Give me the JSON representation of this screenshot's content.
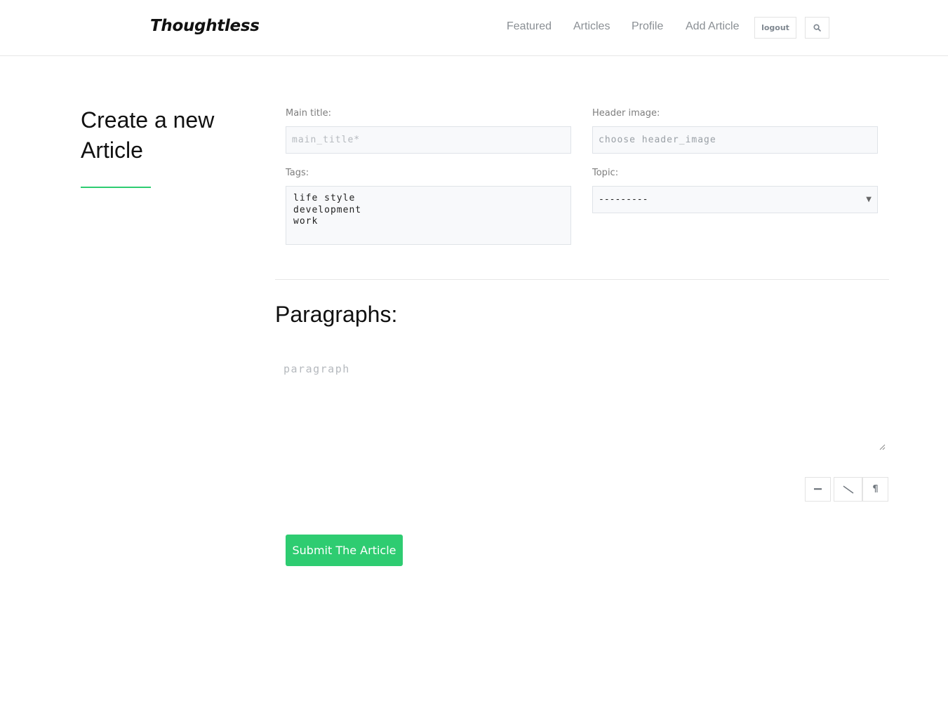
{
  "header": {
    "brand": "Thoughtless",
    "nav": {
      "featured": "Featured",
      "articles": "Articles",
      "profile": "Profile",
      "add_article": "Add Article"
    },
    "logout_label": "logout",
    "search_icon": "search-icon"
  },
  "page": {
    "heading": "Create a new Article",
    "accent_color": "#2ecc71"
  },
  "form": {
    "main_title": {
      "label": "Main title:",
      "placeholder": "main_title*"
    },
    "header_image": {
      "label": "Header image:",
      "placeholder": "choose header_image"
    },
    "tags": {
      "label": "Tags:",
      "options": [
        "life style",
        "development",
        "work"
      ]
    },
    "topic": {
      "label": "Topic:",
      "selected": "---------"
    }
  },
  "paragraphs": {
    "heading": "Paragraphs:",
    "placeholder": "paragraph",
    "tools": {
      "minus_icon": "minus-icon",
      "slash_icon": "slash-icon",
      "pilcrow_glyph": "¶"
    }
  },
  "submit": {
    "label": "Submit The Article"
  }
}
